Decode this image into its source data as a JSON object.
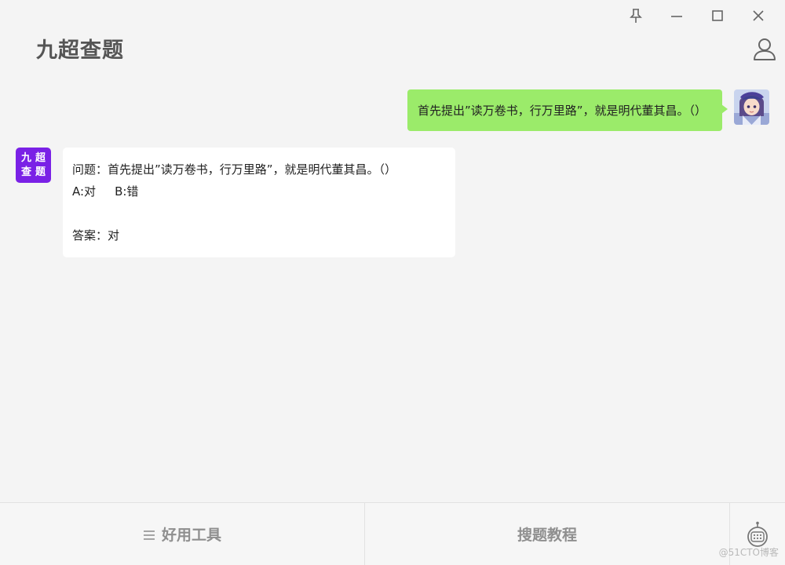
{
  "app": {
    "title": "九超查题"
  },
  "window_controls": [
    "pin-icon",
    "minimize-icon",
    "maximize-icon",
    "close-icon"
  ],
  "user_message": {
    "text": "首先提出”读万卷书，行万里路”，就是明代董其昌。（）"
  },
  "bot": {
    "avatar_line1": "九超",
    "avatar_line2": "查题",
    "question_label": "问题：",
    "question_text": "首先提出”读万卷书，行万里路”，就是明代董其昌。（）",
    "option_a": "A:对",
    "option_b": "B:错",
    "answer_label": "答案：",
    "answer_value": "对"
  },
  "bottom_bar": {
    "tools_label": "好用工具",
    "tutorial_label": "搜题教程"
  },
  "watermark": "@51CTO博客",
  "colors": {
    "user_bubble": "#9beb6a",
    "bot_avatar": "#7a21e6",
    "background": "#f4f4f4"
  }
}
